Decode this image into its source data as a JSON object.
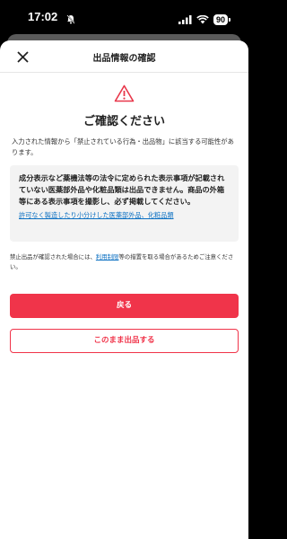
{
  "status_bar": {
    "time": "17:02",
    "battery": "90"
  },
  "header": {
    "title": "出品情報の確認"
  },
  "heading": "ご確認ください",
  "intro": "入力された情報から「禁止されている行為・出品物」に該当する可能性があります。",
  "notice": {
    "text": "成分表示など薬機法等の法令に定められた表示事項が記載されていない医薬部外品や化粧品類は出品できません。商品の外箱等にある表示事項を撮影し、必ず掲載してください。",
    "link": "許可なく製造したり小分けした医薬部外品、化粧品類"
  },
  "footnote": {
    "before": "禁止出品が確認された場合には、",
    "link": "利用制限",
    "after": "等の措置を取る場合があるためご注意ください。"
  },
  "buttons": {
    "back": "戻る",
    "list_anyway": "このまま出品する"
  },
  "colors": {
    "accent": "#f0344a",
    "link": "#0a6fc2"
  }
}
